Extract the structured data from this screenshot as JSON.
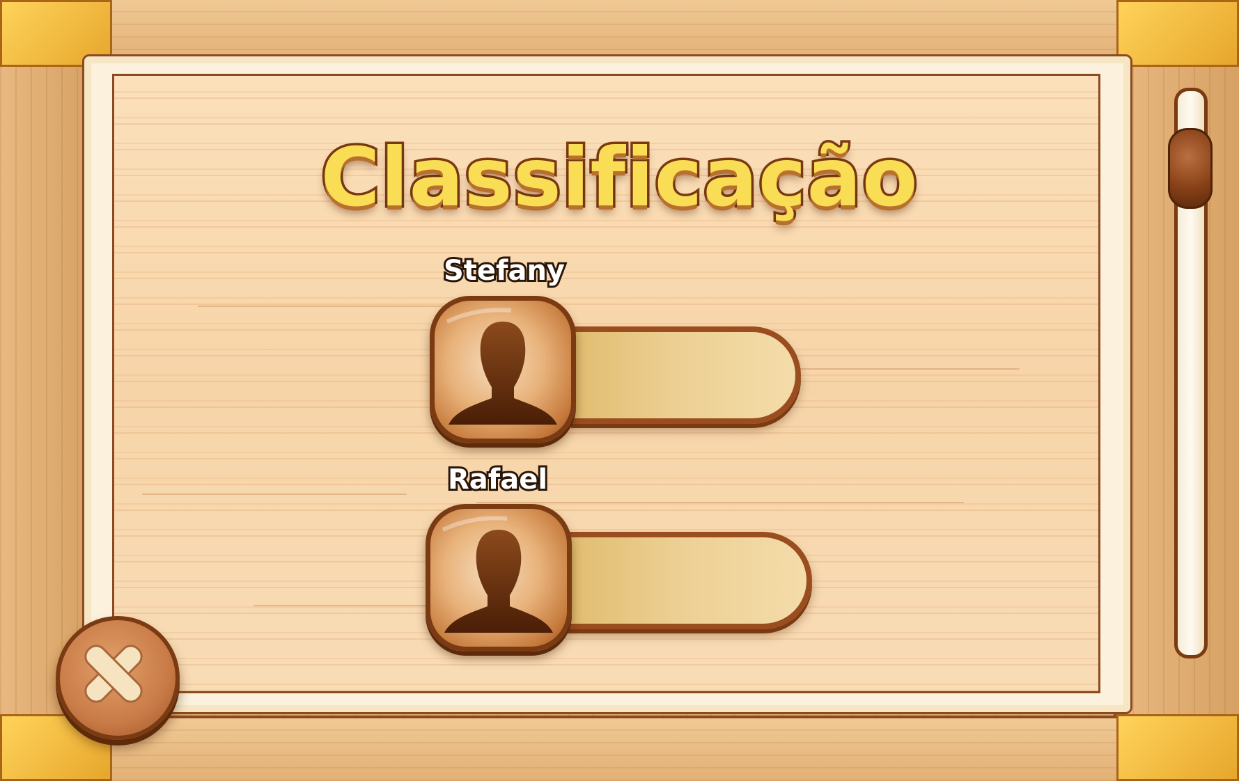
{
  "screen": {
    "title": "Classificação"
  },
  "players": [
    {
      "name": "Stefany",
      "avatar_icon": "person-silhouette-icon"
    },
    {
      "name": "Rafael",
      "avatar_icon": "person-silhouette-icon"
    }
  ],
  "controls": {
    "close_icon": "close-x-icon",
    "scrollbar_position": 0.1
  },
  "colors": {
    "title_fill": "#f9de55",
    "title_outline": "#7a3a12",
    "wood_board": "#f7d4a8",
    "frame_corner": "#ffd35a"
  }
}
